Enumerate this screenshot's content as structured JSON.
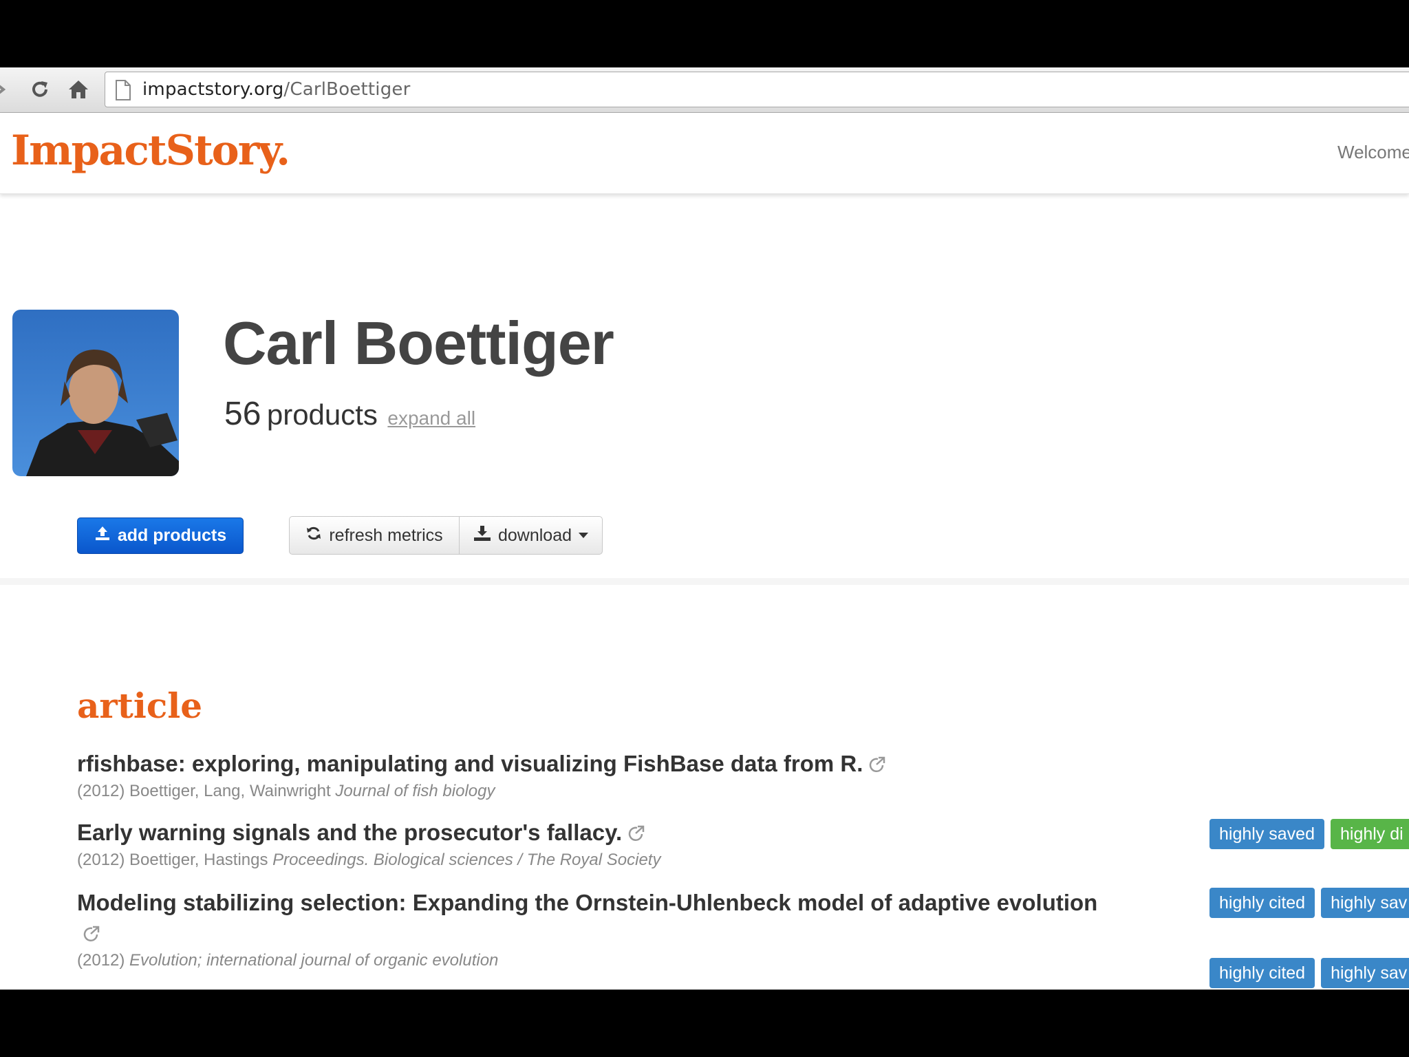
{
  "browser": {
    "url_host": "impactstory.org",
    "url_path": "/CarlBoettiger",
    "icons": [
      "forward-icon",
      "reload-icon",
      "home-icon",
      "page-icon"
    ]
  },
  "header": {
    "logo": "ImpactStory.",
    "welcome": "Welcome"
  },
  "profile": {
    "name": "Carl Boettiger",
    "products_count": "56",
    "products_label": "products",
    "expand_all": "expand all"
  },
  "actions": {
    "add_products": "add products",
    "refresh_metrics": "refresh metrics",
    "download": "download"
  },
  "section": {
    "title": "article"
  },
  "articles": [
    {
      "title": "rfishbase: exploring, manipulating and visualizing FishBase data from R.",
      "year": "(2012)",
      "authors": "Boettiger, Lang, Wainwright",
      "journal": "Journal of fish biology",
      "badges": [
        "highly saved",
        "highly di"
      ]
    },
    {
      "title": "Early warning signals and the prosecutor's fallacy.",
      "year": "(2012)",
      "authors": "Boettiger, Hastings",
      "journal": "Proceedings. Biological sciences / The Royal Society",
      "badges": [
        "highly cited",
        "highly sav"
      ]
    },
    {
      "title": "Modeling stabilizing selection: Expanding the Ornstein-Uhlenbeck model of adaptive evolution",
      "year": "(2012)",
      "authors": "",
      "journal": "Evolution; international journal of organic evolution",
      "badges": [
        "highly cited",
        "highly sav"
      ]
    }
  ],
  "colors": {
    "brand_orange": "#e8611a",
    "primary_blue": "#0a57cc",
    "badge_blue": "#3a87c8",
    "badge_green": "#58b548"
  }
}
